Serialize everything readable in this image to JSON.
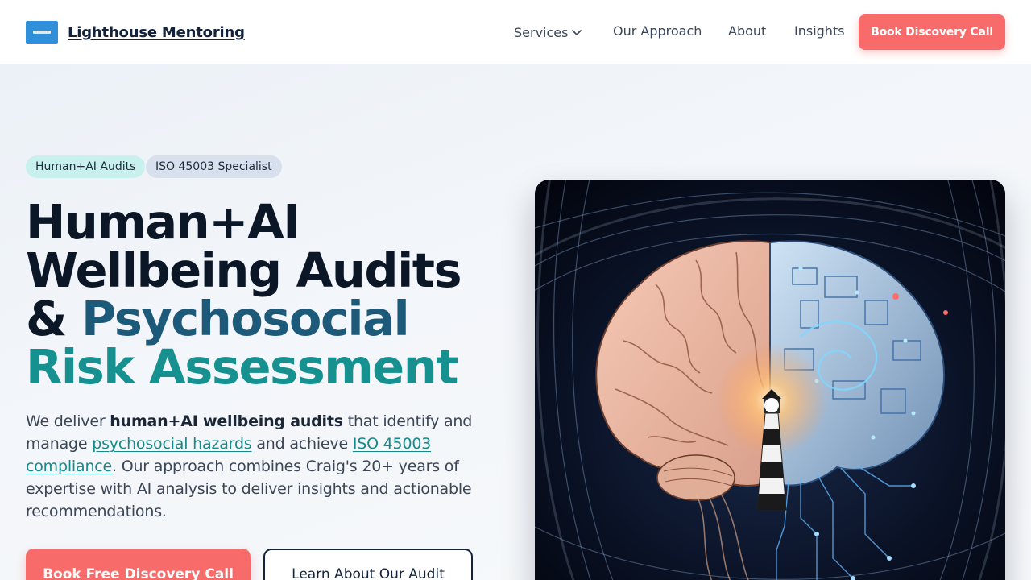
{
  "header": {
    "logo_icon": "lighthouse-logo-icon",
    "brand_name": "Lighthouse Mentoring",
    "nav": {
      "services": "Services",
      "approach": "Our Approach",
      "about": "About",
      "insights": "Insights"
    },
    "cta": "Book Discovery Call"
  },
  "hero": {
    "badges": [
      "Human+AI Audits",
      "ISO 45003 Specialist"
    ],
    "title": {
      "line1": "Human+AI",
      "line2": "Wellbeing Audits",
      "line3_prefix": "& ",
      "line3_accent": "Psychosocial",
      "line4": "Risk Assessment"
    },
    "text": {
      "p1": "We deliver ",
      "bold": "human+AI wellbeing audits",
      "p2": " that identify and manage ",
      "link1": "psychosocial hazards",
      "p3": " and achieve ",
      "link2": "ISO 45003 compliance",
      "p4": ". Our approach combines Craig's 20+ years of expertise with AI analysis to deliver insights and actionable recommendations."
    },
    "primary_button": "Book Free Discovery Call",
    "secondary_button": "Learn About Our Audit",
    "image": {
      "icon": "brain-lighthouse-illustration",
      "alt": ""
    }
  },
  "colors": {
    "coral": "#f86b6b",
    "navy": "#0b1626",
    "blue_accent": "#1d5a7a",
    "teal_accent": "#17918f"
  }
}
